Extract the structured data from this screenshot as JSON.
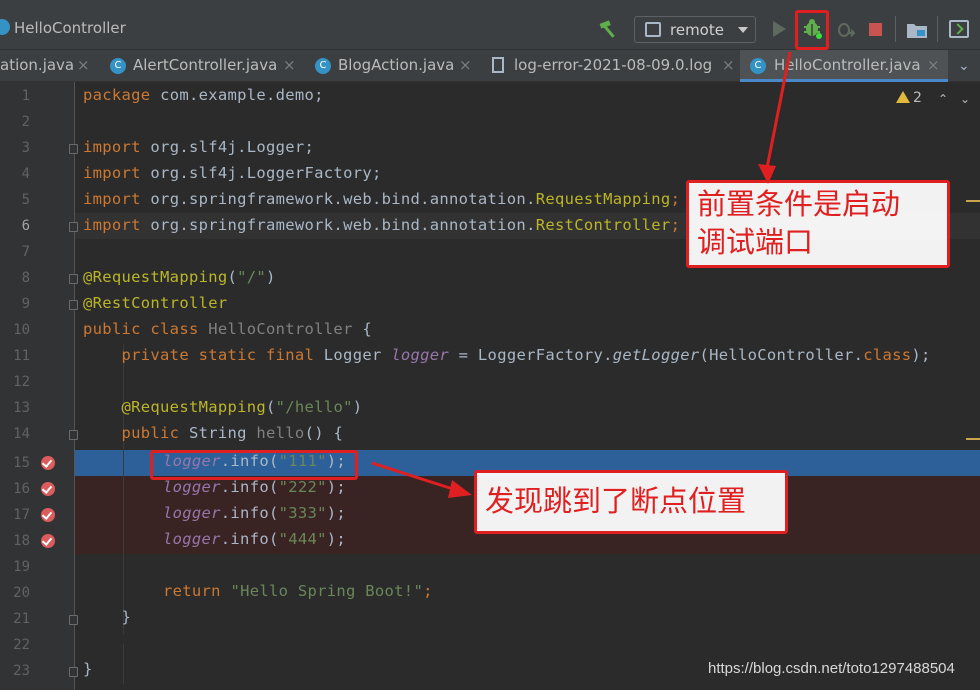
{
  "window": {
    "breadcrumb": "HelloController"
  },
  "toolbar": {
    "run_config": "remote",
    "icons": [
      "hammer-icon",
      "run-icon",
      "debug-icon",
      "attach-debugger-icon",
      "stop-icon",
      "project-structure-icon",
      "terminal-icon"
    ]
  },
  "tabs": [
    {
      "label": "ation.java",
      "icon": "class-icon",
      "active": false
    },
    {
      "label": "AlertController.java",
      "icon": "class-icon",
      "active": false
    },
    {
      "label": "BlogAction.java",
      "icon": "class-icon",
      "active": false
    },
    {
      "label": "log-error-2021-08-09.0.log",
      "icon": "file-icon",
      "active": false
    },
    {
      "label": "HelloController.java",
      "icon": "class-icon",
      "active": true
    }
  ],
  "tab_close": "×",
  "editor": {
    "warnings_count": "2",
    "current_line": 6,
    "execution_line": 15,
    "breakpoint_lines": [
      15,
      16,
      17,
      18
    ],
    "line_numbers": [
      "1",
      "2",
      "3",
      "4",
      "5",
      "6",
      "7",
      "8",
      "9",
      "10",
      "11",
      "12",
      "13",
      "14",
      "15",
      "16",
      "17",
      "18",
      "19",
      "20",
      "21",
      "22",
      "23"
    ],
    "lines": {
      "l1_kw": "package",
      "l1_rest": " com.example.demo;",
      "l3_kw": "import",
      "l3_rest": " org.slf4j.Logger;",
      "l4_kw": "import",
      "l4_rest": " org.slf4j.LoggerFactory;",
      "l5_kw": "import",
      "l5_a": " org.springframework.web.bind.annotation.",
      "l5_b": "RequestMapping",
      "l5_c": ";",
      "l6_kw": "import",
      "l6_a": " org.springframework.web.bind.annotation.",
      "l6_b": "RestController",
      "l6_c": ";",
      "l8_ann": "@RequestMapping",
      "l8_a": "(",
      "l8_str": "\"/\"",
      "l8_b": ")",
      "l9_ann": "@RestController",
      "l10_kw": "public class ",
      "l10_name": "HelloController",
      "l10_rest": " {",
      "l11_kw": "    private static final ",
      "l11_a": "Logger ",
      "l11_field": "logger",
      "l11_b": " = LoggerFactory.",
      "l11_call": "getLogger",
      "l11_c": "(HelloController.",
      "l11_kw2": "class",
      "l11_d": ");",
      "l13_ann": "    @RequestMapping",
      "l13_a": "(",
      "l13_str": "\"/hello\"",
      "l13_b": ")",
      "l14_kw": "    public ",
      "l14_a": "String ",
      "l14_name": "hello",
      "l14_b": "() {",
      "l15_field": "logger",
      "l15_a": ".info(",
      "l15_str": "\"111\"",
      "l15_b": ");",
      "l16_field": "logger",
      "l16_a": ".info(",
      "l16_str": "\"222\"",
      "l16_b": ");",
      "l17_field": "logger",
      "l17_a": ".info(",
      "l17_str": "\"333\"",
      "l17_b": ");",
      "l18_field": "logger",
      "l18_a": ".info(",
      "l18_str": "\"444\"",
      "l18_b": ");",
      "l20_kw": "return ",
      "l20_str": "\"Hello Spring Boot!\"",
      "l20_rest": ";",
      "l21": "    }",
      "l23": "}"
    }
  },
  "annotations": {
    "note_debug_line1": "前置条件是启动",
    "note_debug_line2": "调试端口",
    "note_breakpoint": "发现跳到了断点位置",
    "color": "#e02020"
  },
  "watermark": "https://blog.csdn.net/toto1297488504"
}
